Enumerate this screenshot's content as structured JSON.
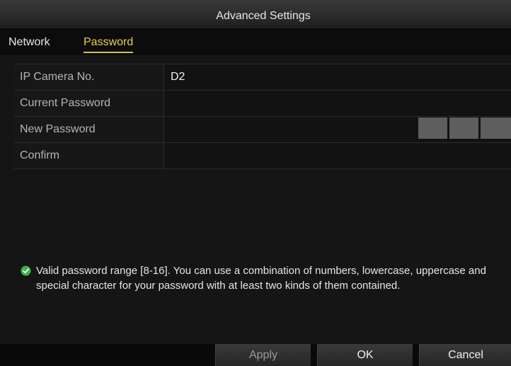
{
  "dialog": {
    "title": "Advanced Settings"
  },
  "tabs": [
    {
      "label": "Network",
      "active": false
    },
    {
      "label": "Password",
      "active": true
    }
  ],
  "form": {
    "rows": [
      {
        "label": "IP Camera No.",
        "value": "D2"
      },
      {
        "label": "Current Password",
        "value": ""
      },
      {
        "label": "New Password",
        "value": ""
      },
      {
        "label": "Confirm",
        "value": ""
      }
    ]
  },
  "tip": {
    "icon": "check-circle-icon",
    "text": "Valid password range [8-16]. You can use a combination of numbers, lowercase, uppercase and special character for your password with at least two kinds of them contained."
  },
  "buttons": {
    "apply": "Apply",
    "ok": "OK",
    "cancel": "Cancel"
  },
  "colors": {
    "accent_tab": "#e8cf55",
    "tip_icon": "#3fb24a",
    "strength_bar": "#5e5e5e"
  }
}
